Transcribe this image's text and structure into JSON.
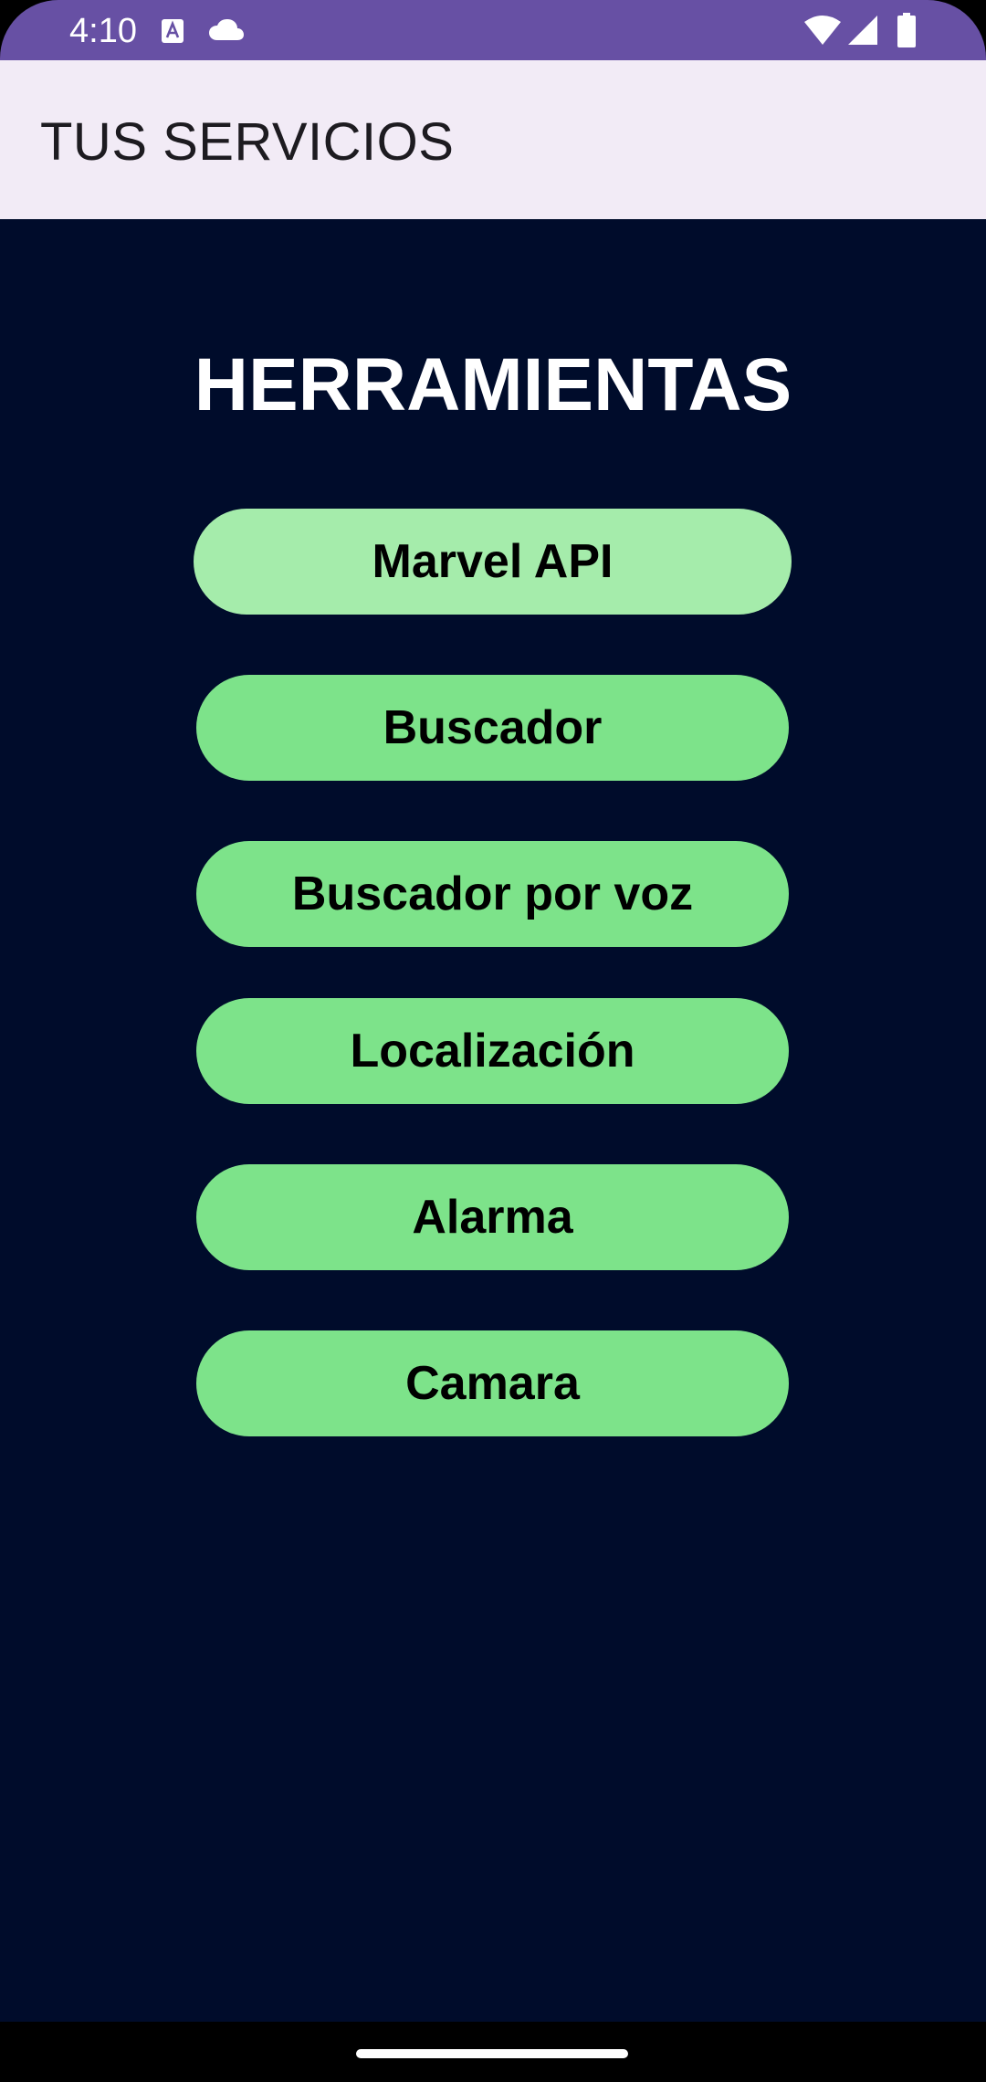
{
  "status_bar": {
    "time": "4:10",
    "icons": [
      "text-a-icon",
      "cloud-icon",
      "wifi-icon",
      "cellular-signal-icon",
      "battery-icon"
    ],
    "background": "#6750a4"
  },
  "app_bar": {
    "title": "TUS SERVICIOS",
    "background": "#f2ebf6"
  },
  "main": {
    "heading": "HERRAMIENTAS",
    "background": "#000c2b",
    "buttons": [
      {
        "label": "Marvel API",
        "state": "pressed"
      },
      {
        "label": "Buscador"
      },
      {
        "label": "Buscador por voz"
      },
      {
        "label": "Localización"
      },
      {
        "label": "Alarma"
      },
      {
        "label": "Camara"
      }
    ],
    "button_color": "#7de38a",
    "pressed_button_color": "#a5ecab"
  }
}
